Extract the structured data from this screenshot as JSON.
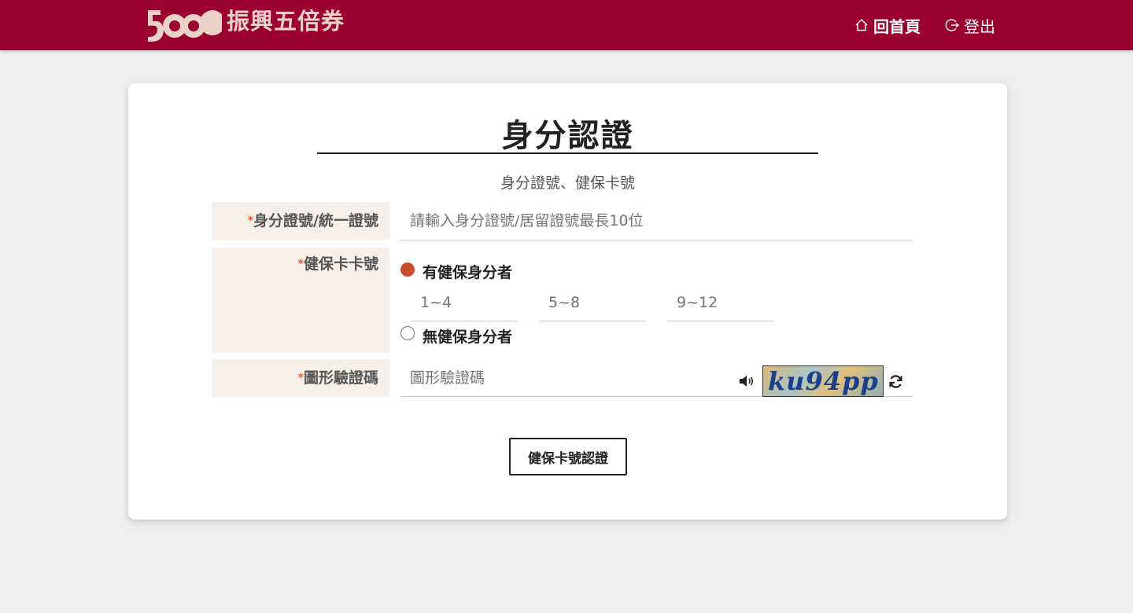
{
  "header": {
    "logo_number": "5000",
    "logo_text": "振興五倍券",
    "home_label": "回首頁",
    "logout_label": "登出",
    "bg_color": "#9b0232"
  },
  "form": {
    "title": "身分認證",
    "subtitle": "身分證號、健保卡號",
    "id_field": {
      "required_mark": "*",
      "label": "身分證號/統一證號",
      "placeholder": "請輸入身分證號/居留證號最長10位",
      "value": ""
    },
    "card_field": {
      "required_mark": "*",
      "label": "健保卡卡號",
      "option_with": "有健保身分者",
      "option_without": "無健保身分者",
      "selected": "有健保身分者",
      "segments": [
        {
          "placeholder": "1~4"
        },
        {
          "placeholder": "5~8"
        },
        {
          "placeholder": "9~12"
        }
      ]
    },
    "captcha_field": {
      "required_mark": "*",
      "label": "圖形驗證碼",
      "placeholder": "圖形驗證碼",
      "captcha_text": "ku94pp",
      "audio_icon": "speaker-icon",
      "refresh_icon": "refresh-icon"
    },
    "submit_label": "健保卡號認證"
  }
}
